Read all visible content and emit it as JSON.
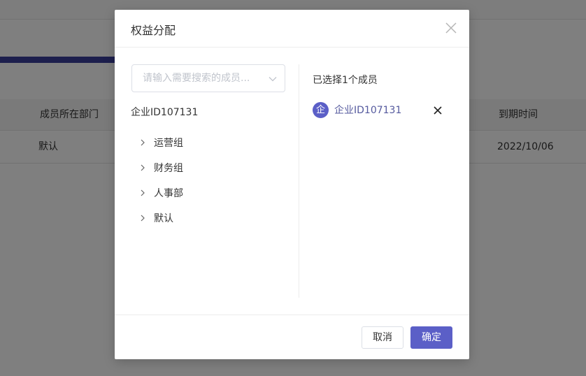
{
  "background": {
    "table": {
      "headers": [
        "成员所在部门",
        "到期时间"
      ],
      "rows": [
        {
          "department": "默认",
          "expire": "2022/10/06"
        }
      ]
    }
  },
  "modal": {
    "title": "权益分配",
    "close_icon": "close-icon",
    "search": {
      "placeholder": "请输入需要搜索的成员...",
      "value": ""
    },
    "tree": {
      "root": "企业ID107131",
      "children": [
        "运营组",
        "财务组",
        "人事部",
        "默认"
      ]
    },
    "selected": {
      "count_text": "已选择1个成员",
      "items": [
        {
          "avatar": "企",
          "name": "企业ID107131"
        }
      ]
    },
    "footer": {
      "cancel_label": "取消",
      "ok_label": "确定"
    }
  },
  "colors": {
    "accent": "#5b5fc7",
    "mask": "rgba(0,0,0,0.5)",
    "background_accent_bar": "#3a3f9a"
  }
}
